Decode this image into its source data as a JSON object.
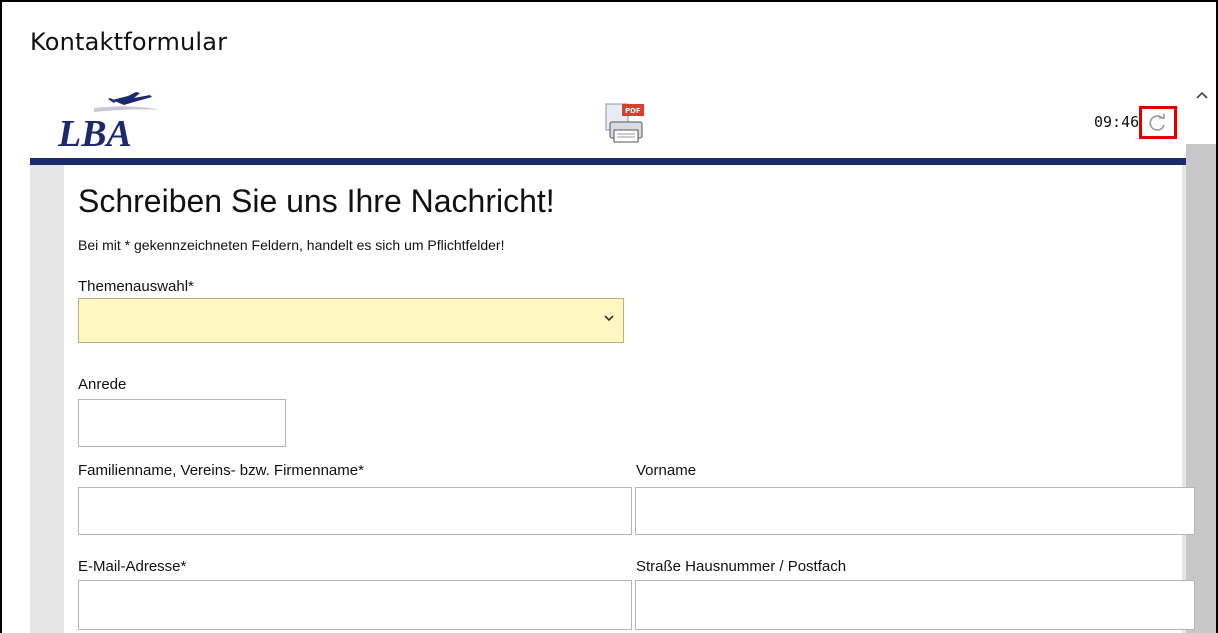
{
  "window": {
    "title": "Kontaktformular"
  },
  "header": {
    "logo_text": "LBA",
    "time": "09:46",
    "icons": {
      "pdf": "pdf-print-icon",
      "refresh": "refresh-icon",
      "scroll_up": "chevron-up-icon"
    },
    "colors": {
      "rule": "#1c2a6d",
      "highlight": "#e00000"
    }
  },
  "form": {
    "heading": "Schreiben Sie uns Ihre Nachricht!",
    "note": "Bei mit * gekennzeichneten Feldern, handelt es sich um Pflichtfelder!",
    "topic": {
      "label": "Themenauswahl*",
      "value": ""
    },
    "salutation": {
      "label": "Anrede",
      "value": ""
    },
    "last_name": {
      "label": "Familienname, Vereins- bzw. Firmenname*",
      "value": ""
    },
    "first_name": {
      "label": "Vorname",
      "value": ""
    },
    "email": {
      "label": "E-Mail-Adresse*",
      "value": ""
    },
    "street": {
      "label": "Straße Hausnummer / Postfach",
      "value": ""
    },
    "select_color": "#fef7c4"
  }
}
